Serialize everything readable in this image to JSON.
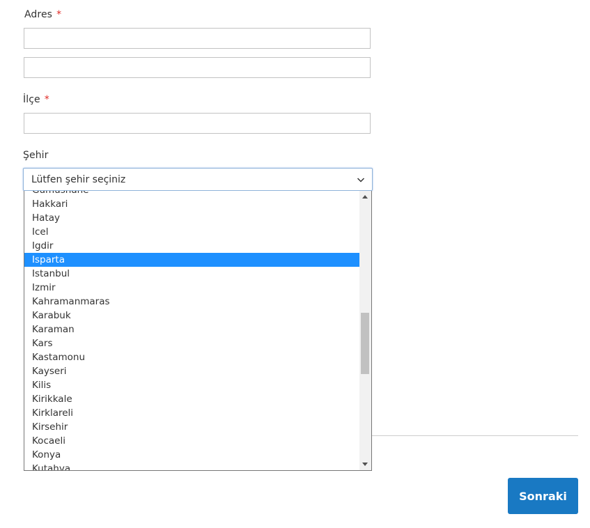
{
  "form": {
    "address": {
      "label": "Adres",
      "required_mark": "*",
      "line1_value": "",
      "line2_value": ""
    },
    "district": {
      "label": "İlçe",
      "required_mark": "*",
      "value": ""
    },
    "city": {
      "label": "Şehir",
      "selected_display": "Lütfen şehir seçiniz",
      "highlighted_option": "Isparta",
      "options": [
        "Gumushane",
        "Hakkari",
        "Hatay",
        "Icel",
        "Igdir",
        "Isparta",
        "Istanbul",
        "Izmir",
        "Kahramanmaras",
        "Karabuk",
        "Karaman",
        "Kars",
        "Kastamonu",
        "Kayseri",
        "Kilis",
        "Kirikkale",
        "Kirklareli",
        "Kirsehir",
        "Kocaeli",
        "Konya",
        "Kutahya"
      ]
    },
    "next_button": {
      "label": "Sonraki"
    }
  },
  "colors": {
    "accent": "#1979c3",
    "highlight": "#1e90ff",
    "required": "#e02b27"
  }
}
